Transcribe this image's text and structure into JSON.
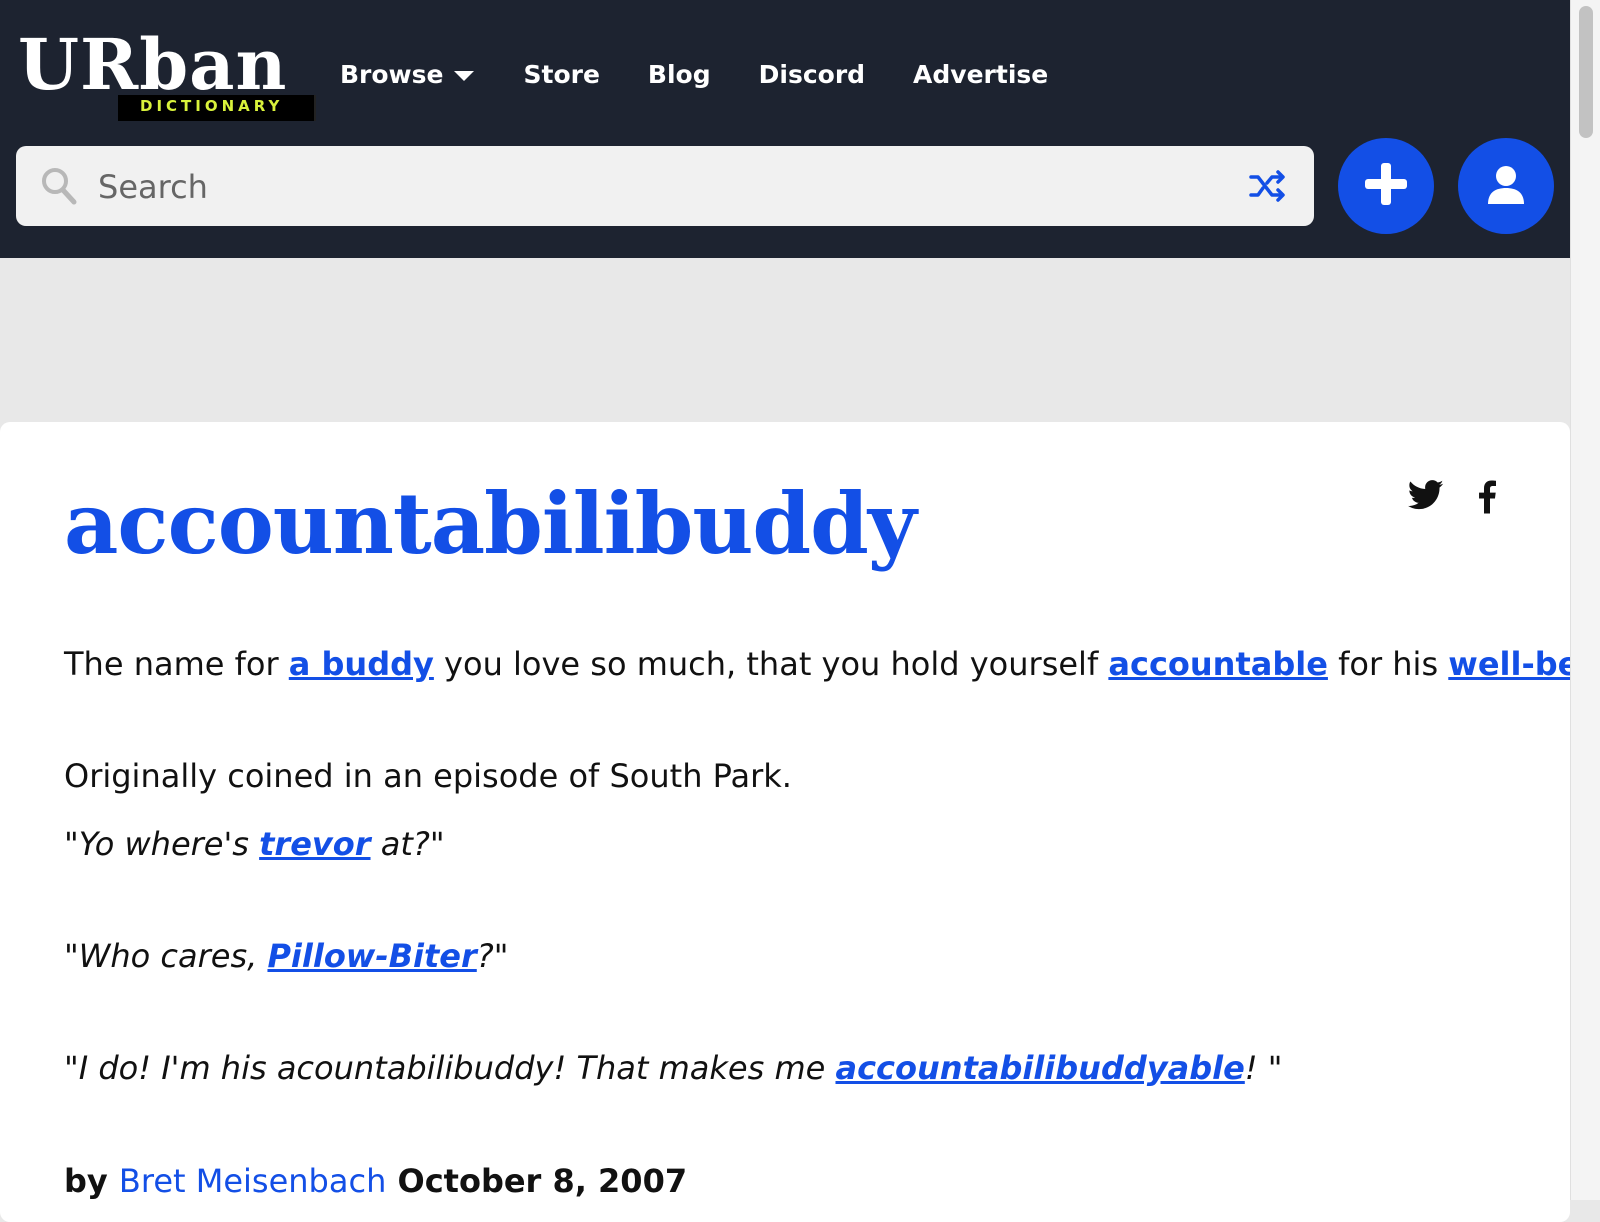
{
  "header": {
    "logo": {
      "word": "URban",
      "tag": "DICTIONARY"
    },
    "nav": [
      {
        "label": "Browse",
        "has_dropdown": true
      },
      {
        "label": "Store"
      },
      {
        "label": "Blog"
      },
      {
        "label": "Discord"
      },
      {
        "label": "Advertise"
      }
    ],
    "search": {
      "placeholder": "Search",
      "value": ""
    },
    "icons": {
      "search": "search-icon",
      "shuffle": "shuffle-icon",
      "add": "plus-icon",
      "user": "user-icon"
    }
  },
  "entry": {
    "word": "accountabilibuddy",
    "share": {
      "twitter": "twitter-icon",
      "facebook": "facebook-icon"
    },
    "meaning": {
      "p1": {
        "t1": "The name for ",
        "l1": "a buddy",
        "t2": " you love so much, that you hold yourself ",
        "l2": "accountable",
        "t3": " for his ",
        "l3": "well-being",
        "t4": "."
      },
      "p2": "Originally coined in an episode of South Park."
    },
    "examples": [
      {
        "before": "\"Yo where's ",
        "link": "trevor",
        "after": " at?\""
      },
      {
        "before": "\"Who cares, ",
        "link": "Pillow-Biter",
        "after": "?\""
      },
      {
        "before": "\"I do! I'm his acountabilibuddy! That makes me ",
        "link": "accountabilibuddyable",
        "after": "! \""
      }
    ],
    "byline": {
      "by": "by",
      "author": "Bret Meisenbach",
      "date": "October 8, 2007"
    }
  },
  "colors": {
    "header_bg": "#1d2330",
    "accent_blue": "#134fe6",
    "logo_tag_text": "#d9f23b",
    "page_bg": "#e8e8e8"
  }
}
